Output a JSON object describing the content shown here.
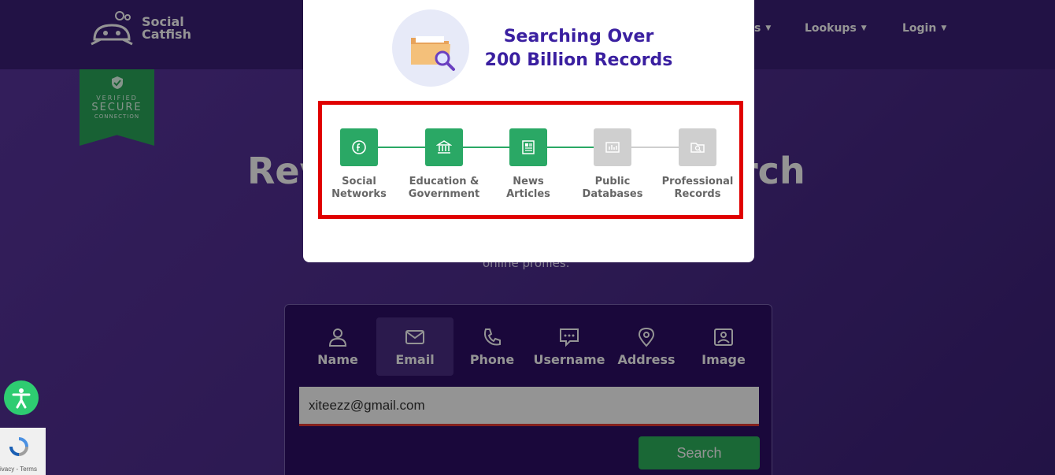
{
  "header": {
    "logo_line1": "Social",
    "logo_line2": "Catfish",
    "nav": [
      {
        "label": "s"
      },
      {
        "label": "Lookups"
      },
      {
        "label": "Login"
      }
    ]
  },
  "badge": {
    "line1": "VERIFIED",
    "line2": "SECURE",
    "line3": "CONNECTION"
  },
  "hero": {
    "title_left": "Rev",
    "title_right": "rch",
    "subtitle": "online profiles."
  },
  "search": {
    "tabs": [
      {
        "label": "Name",
        "icon": "user-icon"
      },
      {
        "label": "Email",
        "icon": "envelope-icon"
      },
      {
        "label": "Phone",
        "icon": "phone-icon"
      },
      {
        "label": "Username",
        "icon": "chat-icon"
      },
      {
        "label": "Address",
        "icon": "map-pin-icon"
      },
      {
        "label": "Image",
        "icon": "image-icon"
      }
    ],
    "active_tab": "Email",
    "email_value": "xiteezz@gmail.com",
    "button_label": "Search"
  },
  "modal": {
    "title_line1": "Searching Over",
    "title_line2": "200 Billion Records",
    "steps": [
      {
        "line1": "Social",
        "line2": "Networks",
        "status": "done",
        "icon": "facebook-icon"
      },
      {
        "line1": "Education &",
        "line2": "Government",
        "status": "done",
        "icon": "bank-icon"
      },
      {
        "line1": "News",
        "line2": "Articles",
        "status": "done",
        "icon": "newspaper-icon"
      },
      {
        "line1": "Public",
        "line2": "Databases",
        "status": "pending",
        "icon": "database-chart-icon"
      },
      {
        "line1": "Professional",
        "line2": "Records",
        "status": "pending",
        "icon": "folder-search-icon"
      }
    ]
  },
  "recaptcha": {
    "text": "Privacy - Terms"
  },
  "colors": {
    "accent_purple": "#3a1fa0",
    "step_done": "#2aa865",
    "step_pending": "#cfcfcf",
    "highlight_border": "#e00000",
    "search_button": "#2db35e"
  }
}
